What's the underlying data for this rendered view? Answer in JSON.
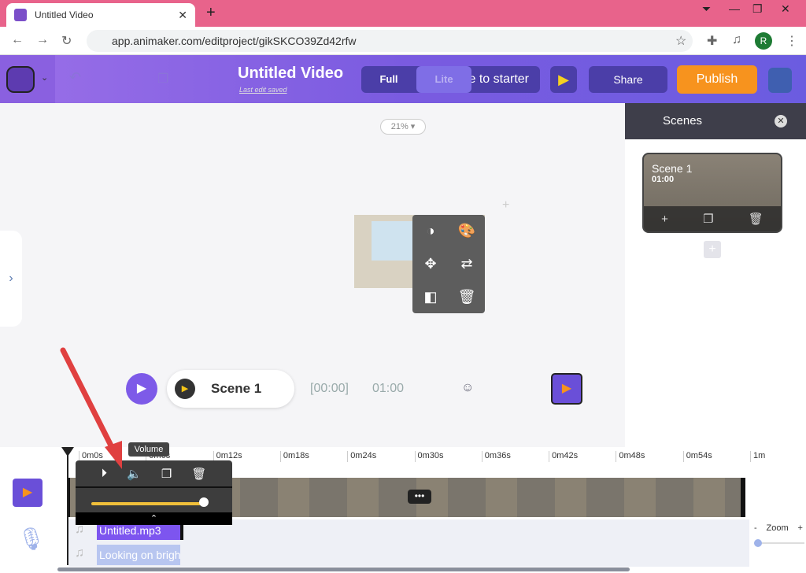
{
  "browser": {
    "tab_title": "Untitled Video",
    "url": "app.animaker.com/editproject/gikSKCO39Zd42rfw",
    "profile_initial": "R"
  },
  "header": {
    "title": "Untitled Video",
    "saved": "Last edit saved",
    "mode_full": "Full",
    "mode_lite": "Lite",
    "starter": "e to starter",
    "share": "Share",
    "publish": "Publish"
  },
  "canvas": {
    "zoom": "21% ▾"
  },
  "scenes": {
    "title": "Scenes",
    "items": [
      {
        "name": "Scene 1",
        "duration": "01:00"
      }
    ]
  },
  "player": {
    "scene": "Scene 1",
    "current": "[00:00]",
    "total": "01:00"
  },
  "timeline": {
    "ticks": [
      "0m0s",
      "0m6s",
      "0m12s",
      "0m18s",
      "0m24s",
      "0m30s",
      "0m36s",
      "0m42s",
      "0m48s",
      "0m54s",
      "1m"
    ],
    "tooltip": "Volume",
    "volume": 0.95,
    "audio": [
      "Untitled.mp3",
      "Looking on brigh"
    ],
    "zoom_label": "Zoom",
    "zoom_minus": "-",
    "zoom_plus": "+"
  },
  "colors": {
    "accent": "#7d5ae8",
    "publish": "#f7931e",
    "volume": "#f0bf3a"
  }
}
